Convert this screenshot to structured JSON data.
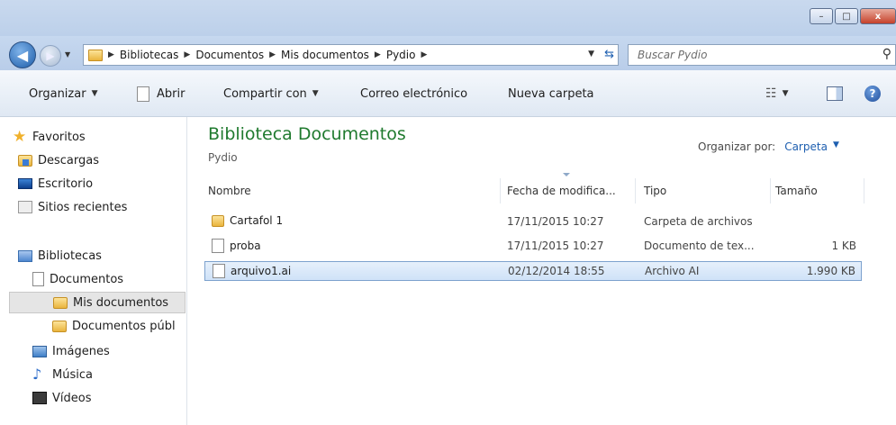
{
  "window": {
    "title_buttons": {
      "minimize": "–",
      "maximize": "□",
      "close": "x"
    }
  },
  "address_bar": {
    "back_icon": "back-arrow-icon",
    "forward_icon": "forward-arrow-icon",
    "breadcrumbs": [
      "Bibliotecas",
      "Documentos",
      "Mis documentos",
      "Pydio"
    ],
    "search_placeholder": "Buscar Pydio"
  },
  "toolbar": {
    "organize": "Organizar",
    "open": "Abrir",
    "share": "Compartir con",
    "email": "Correo electrónico",
    "new_folder": "Nueva carpeta"
  },
  "nav": {
    "favorites": {
      "label": "Favoritos",
      "items": [
        {
          "label": "Descargas",
          "icon": "downloads-folder-icon"
        },
        {
          "label": "Escritorio",
          "icon": "desktop-icon"
        },
        {
          "label": "Sitios recientes",
          "icon": "recent-places-icon"
        }
      ]
    },
    "libraries": {
      "label": "Bibliotecas",
      "items": [
        {
          "label": "Documentos",
          "icon": "documents-icon"
        },
        {
          "label": "Mis documentos",
          "icon": "folder-icon",
          "selected": true
        },
        {
          "label": "Documentos públ",
          "icon": "folder-icon"
        },
        {
          "label": "Imágenes",
          "icon": "pictures-icon"
        },
        {
          "label": "Música",
          "icon": "music-icon"
        },
        {
          "label": "Vídeos",
          "icon": "videos-icon"
        }
      ]
    }
  },
  "content": {
    "library_title": "Biblioteca Documentos",
    "library_subtitle": "Pydio",
    "arrange_label": "Organizar por:",
    "arrange_value": "Carpeta",
    "columns": {
      "name": "Nombre",
      "date": "Fecha de modifica...",
      "type": "Tipo",
      "size": "Tamaño"
    },
    "files": [
      {
        "name": "Cartafol 1",
        "date": "17/11/2015 10:27",
        "type": "Carpeta de archivos",
        "size": "",
        "icon": "folder-icon"
      },
      {
        "name": "proba",
        "date": "17/11/2015 10:27",
        "type": "Documento de tex...",
        "size": "1 KB",
        "icon": "text-file-icon"
      },
      {
        "name": "arquivo1.ai",
        "date": "02/12/2014 18:55",
        "type": "Archivo AI",
        "size": "1.990 KB",
        "icon": "file-icon",
        "selected": true
      }
    ]
  },
  "colors": {
    "title_green": "#1f7a2e",
    "link_blue": "#1e5fb0",
    "selection_border": "#7da2ce"
  }
}
